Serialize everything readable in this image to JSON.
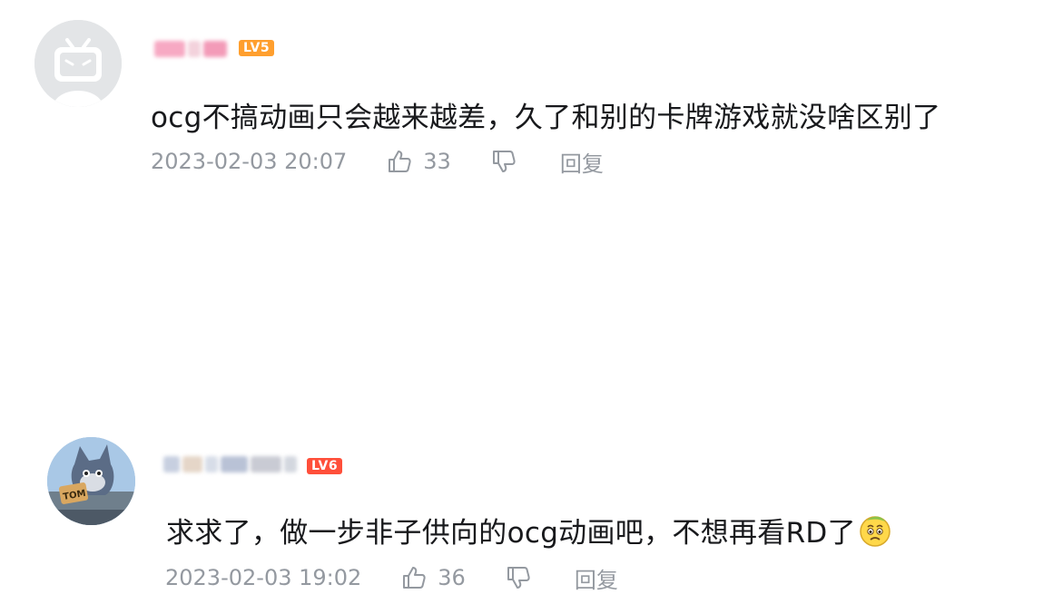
{
  "comments": [
    {
      "level": "LV5",
      "text": "ocg不搞动画只会越来越差，久了和别的卡牌游戏就没啥区别了",
      "date": "2023-02-03 20:07",
      "likes": "33",
      "reply": "回复"
    },
    {
      "level": "LV6",
      "text": "求求了，做一步非子供向的ocg动画吧，不想再看RD了",
      "avatar_badge": "TOM",
      "date": "2023-02-03 19:02",
      "likes": "36",
      "reply": "回复"
    }
  ],
  "colors": {
    "lv5": "#ff9f2e",
    "lv6": "#ff4f3a",
    "meta": "#9499a0",
    "text": "#18191c"
  },
  "icons": [
    "tv-avatar-icon",
    "thumb-up-icon",
    "thumb-down-icon",
    "worried-face-emoji"
  ]
}
